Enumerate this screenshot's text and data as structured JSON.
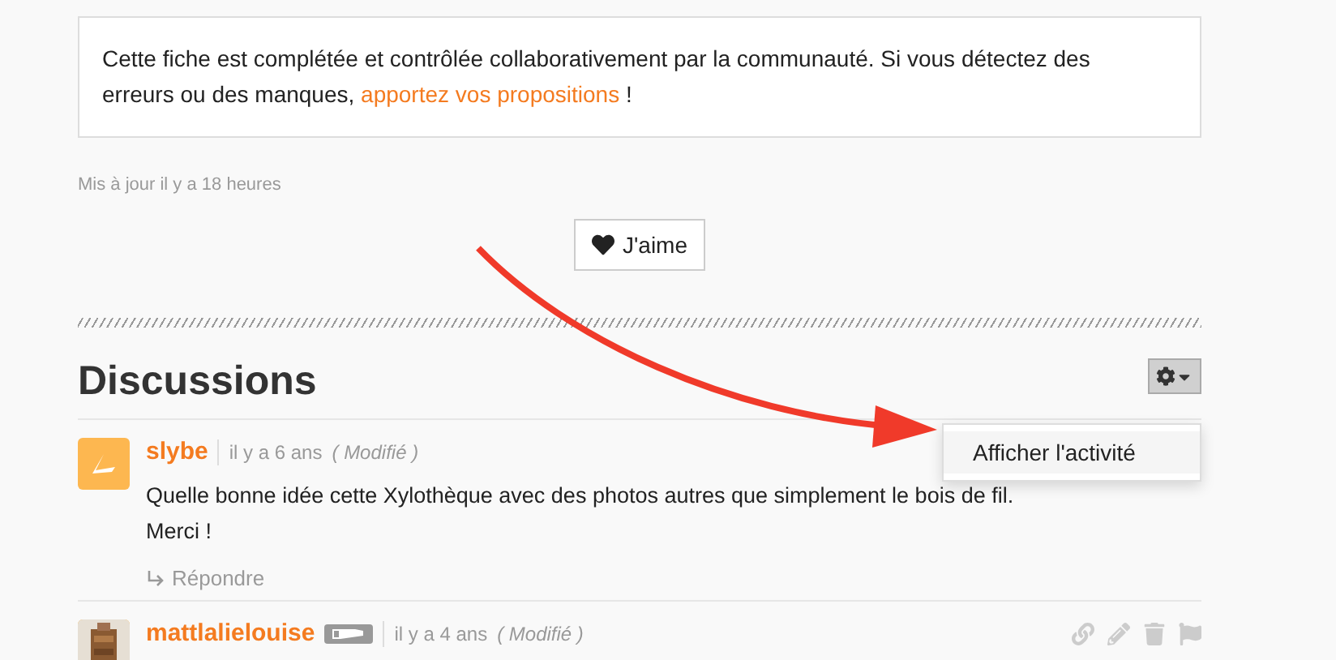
{
  "notice": {
    "text": "Cette fiche est complétée et contrôlée collaborativement par la communauté. Si vous détectez des erreurs ou des manques, ",
    "link": "apportez vos propositions",
    "after": " !"
  },
  "updated": "Mis à jour il y a 18 heures",
  "like_button": "J'aime",
  "discussions": {
    "title": "Discussions",
    "menu": {
      "open": true,
      "items": [
        "Afficher l'activité"
      ]
    },
    "comments": [
      {
        "author": "slybe",
        "badge": false,
        "time": "il y a 6 ans",
        "edited": "( Modifié )",
        "lines": [
          "Quelle bonne idée cette Xylothèque avec des photos autres que simplement le bois de fil.",
          "Merci !"
        ],
        "reply": "Répondre"
      },
      {
        "author": "mattlalielouise",
        "badge": true,
        "time": "il y a 4 ans",
        "edited": "( Modifié )"
      }
    ]
  }
}
